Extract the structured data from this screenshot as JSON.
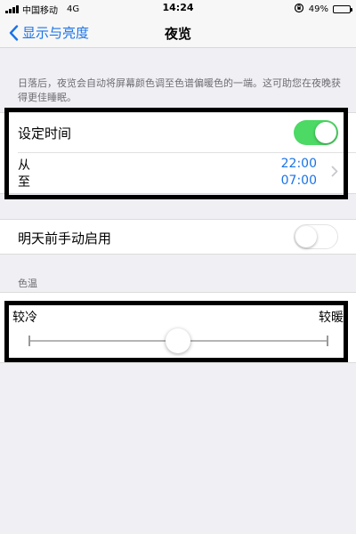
{
  "status_bar": {
    "carrier": "中国移动",
    "network": "4G",
    "time": "14:24",
    "battery": "49%",
    "battery_level": 0.49,
    "icons": [
      "signal-bars-icon",
      "rotation-lock-icon",
      "battery-icon"
    ]
  },
  "nav": {
    "back_label": "显示与亮度",
    "title": "夜览"
  },
  "description": "日落后，夜览会自动将屏幕颜色调至色谱偏暖色的一端。这可助您在夜晚获得更佳睡眠。",
  "schedule": {
    "label": "设定时间",
    "enabled": true,
    "from_label": "从",
    "to_label": "至",
    "from_time": "22:00",
    "to_time": "07:00"
  },
  "manual": {
    "label": "明天前手动启用",
    "enabled": false
  },
  "color_temp": {
    "section_label": "色温",
    "cooler_label": "较冷",
    "warmer_label": "较暖",
    "value": 0.5
  },
  "colors": {
    "accent": "#1a73e8",
    "switch_on": "#4cd964",
    "background": "#efeff4"
  }
}
